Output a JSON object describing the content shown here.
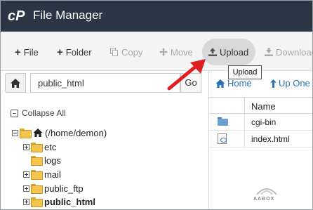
{
  "app": {
    "title": "File Manager"
  },
  "toolbar": {
    "file": "File",
    "folder": "Folder",
    "copy": "Copy",
    "move": "Move",
    "upload": "Upload",
    "download": "Download"
  },
  "tooltip": {
    "text": "Upload"
  },
  "address": {
    "path": "public_html",
    "go": "Go"
  },
  "nav": {
    "home": "Home",
    "up_one": "Up One"
  },
  "tree": {
    "collapse_all": "Collapse All",
    "root": "(/home/demon)",
    "items": [
      {
        "label": "etc",
        "expandable": true
      },
      {
        "label": "logs",
        "expandable": false
      },
      {
        "label": "mail",
        "expandable": true
      },
      {
        "label": "public_ftp",
        "expandable": true
      },
      {
        "label": "public_html",
        "expandable": true,
        "selected": true
      }
    ]
  },
  "table": {
    "header": "Name",
    "rows": [
      {
        "name": "cgi-bin",
        "icon": "folder-icon"
      },
      {
        "name": "index.html",
        "icon": "html-file-icon"
      }
    ]
  },
  "watermark": "AABOX",
  "colors": {
    "titlebar": "#2a3645",
    "link": "#2a72b5",
    "arrow": "#e02020"
  }
}
